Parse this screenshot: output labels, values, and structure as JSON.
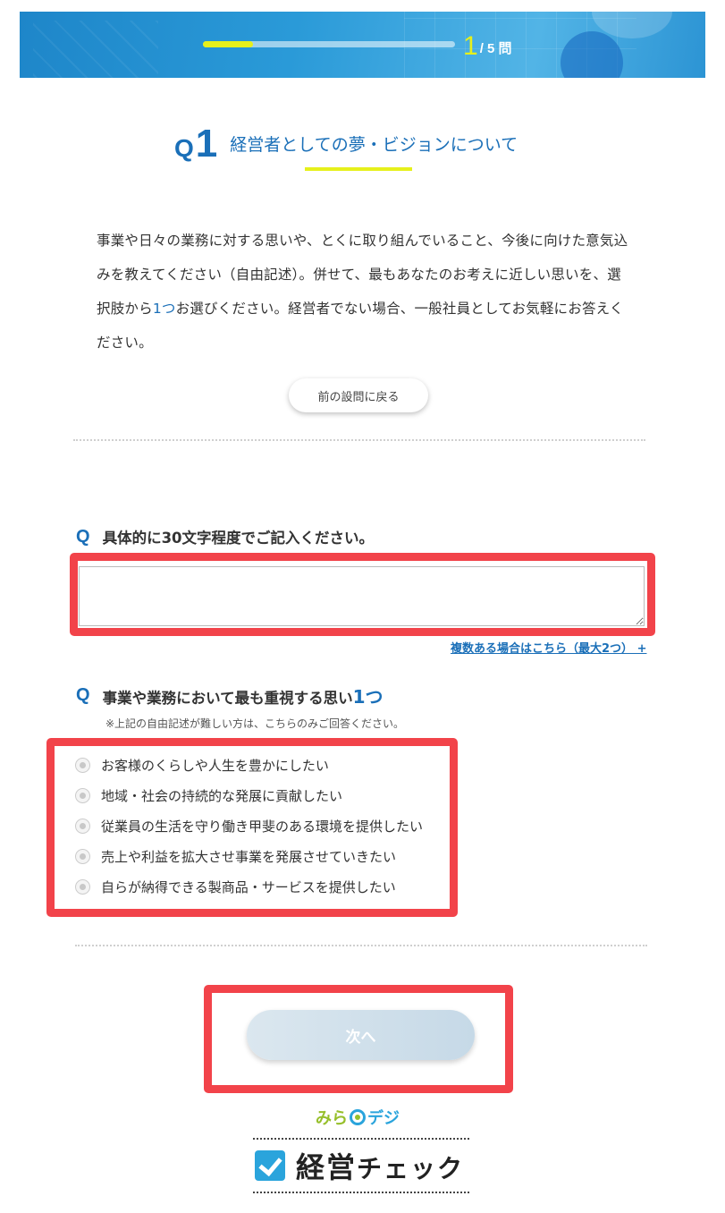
{
  "header": {
    "progress": {
      "current": "1",
      "total_label": "/ 5 問",
      "fraction": 0.2
    }
  },
  "question": {
    "prefix": "Q",
    "number": "1",
    "title": "経営者としての夢・ビジョンについて",
    "intro_before": "事業や日々の業務に対する思いや、とくに取り組んでいること、今後に向けた意気込みを教えてください（自由記述）。併せて、最もあなたのお考えに近しい思いを、選択肢から",
    "intro_accent": "1つ",
    "intro_after": "お選びください。経営者でない場合、一般社員としてお気軽にお答えください。"
  },
  "back_button": "前の設問に戻る",
  "free_text": {
    "mark": "Q",
    "label": "具体的に30文字程度でご記入ください。",
    "value": "",
    "more_link": "複数ある場合はこちら（最大2つ） +"
  },
  "choice": {
    "mark": "Q",
    "label": "事業や業務において最も重視する思い",
    "label_accent": "1つ",
    "note": "※上記の自由記述が難しい方は、こちらのみご回答ください。",
    "options": [
      "お客様のくらしや人生を豊かにしたい",
      "地域・社会の持続的な発展に貢献したい",
      "従業員の生活を守り働き甲斐のある環境を提供したい",
      "売上や利益を拡大させ事業を発展させていきたい",
      "自らが納得できる製商品・サービスを提供したい"
    ]
  },
  "next_button": "次へ",
  "footer": {
    "brand_part1": "みら",
    "brand_part2": "デジ",
    "logo_text_a": "経営",
    "logo_text_b": "チェック"
  },
  "colors": {
    "accent_blue": "#1a6fb8",
    "accent_yellow": "#e6f01b",
    "highlight_red": "#f2434a"
  }
}
